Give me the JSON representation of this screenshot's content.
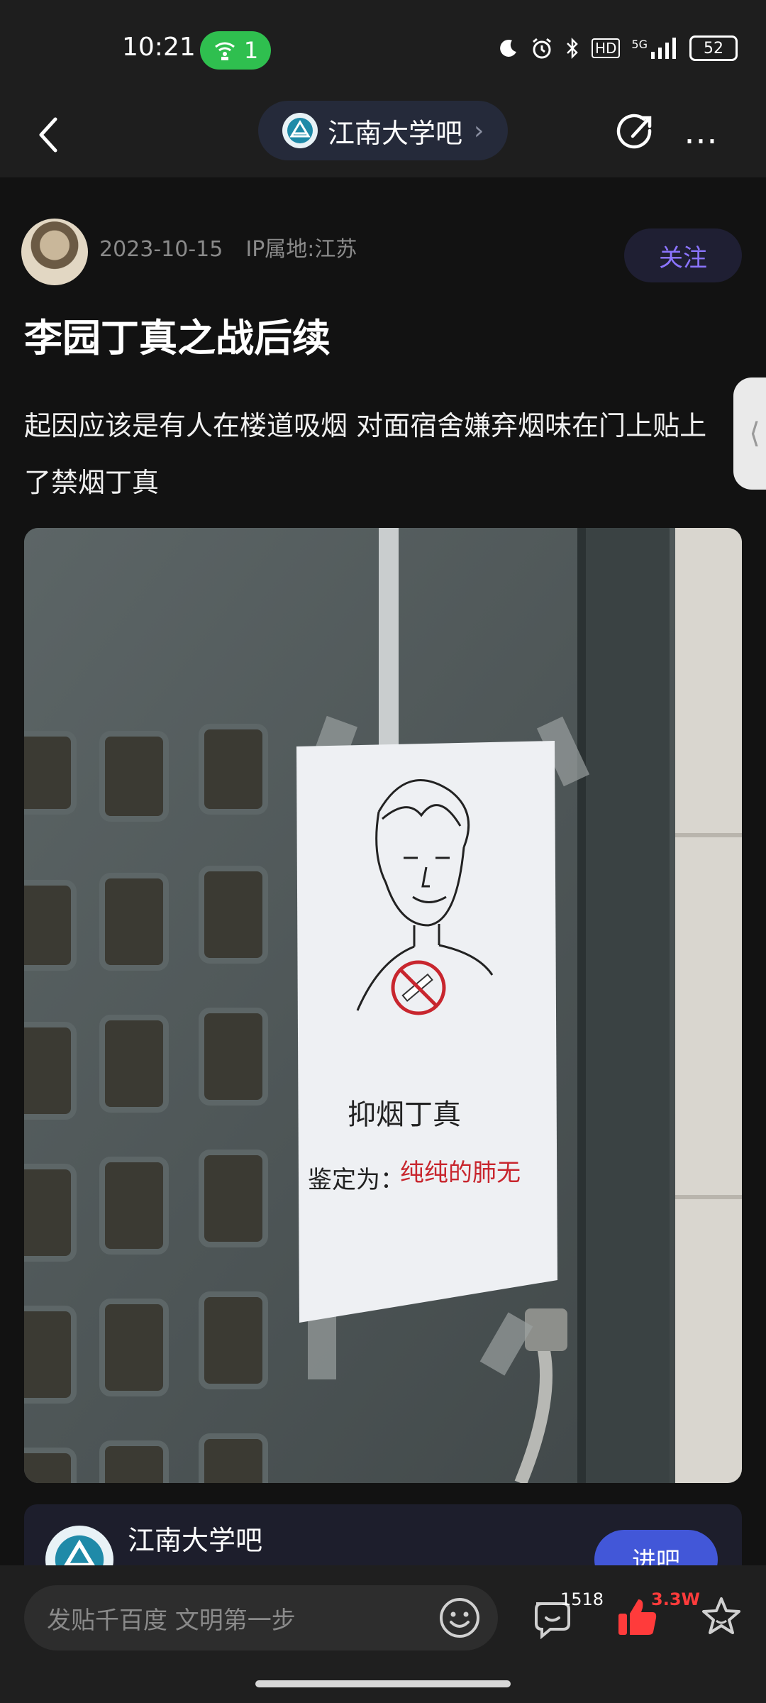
{
  "status_bar": {
    "time": "10:21",
    "hotspot_count": "1",
    "network": "5G",
    "hd": "HD",
    "battery": "52"
  },
  "nav": {
    "forum_name": "江南大学吧",
    "chevron": "›"
  },
  "post": {
    "date": "2023-10-15",
    "ip_location": "IP属地:江苏",
    "follow_label": "关注",
    "title": "李园丁真之战后续",
    "body": "起因应该是有人在楼道吸烟 对面宿舍嫌弃烟味在门上贴上了禁烟丁真",
    "image": {
      "poster_line1": "抑烟丁真",
      "poster_line2_label": "鉴定为：",
      "poster_line2_red": "纯纯的肺无"
    }
  },
  "forum_card": {
    "name": "江南大学吧",
    "button_label": "进吧"
  },
  "bottom_bar": {
    "input_placeholder": "发贴千百度 文明第一步",
    "comment_count": "1518",
    "like_count": "3.3W"
  },
  "icons": {
    "back": "back-arrow-icon",
    "share": "share-icon",
    "more": "more-icon",
    "emoji": "emoji-icon",
    "comment": "comment-icon",
    "like": "thumbs-up-icon",
    "favorite": "star-icon"
  },
  "colors": {
    "accent": "#8b74ff",
    "like": "#ff3b3b",
    "hotspot": "#2fbf4f",
    "enter_button": "#4257d8"
  }
}
